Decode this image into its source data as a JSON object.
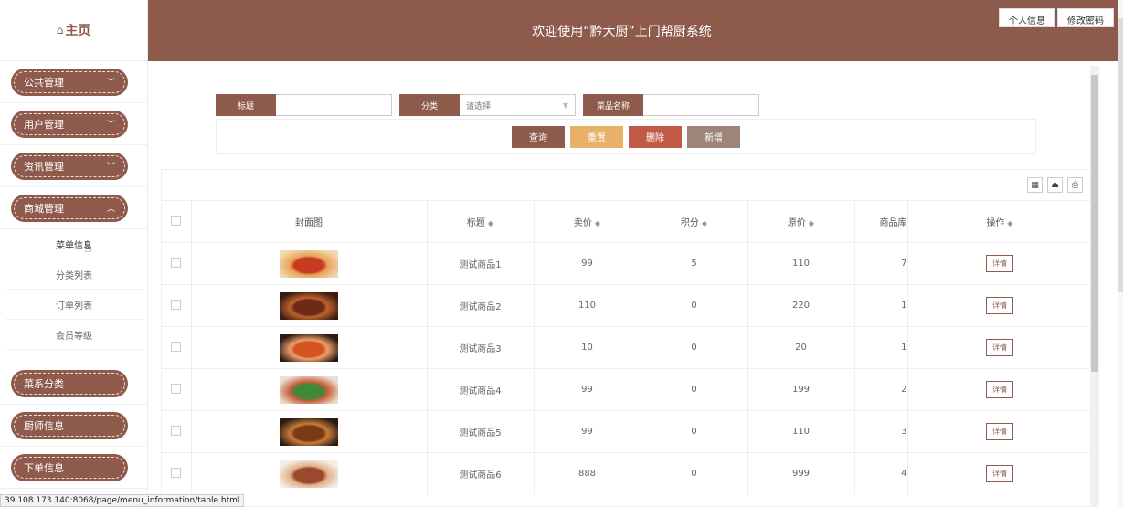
{
  "brand": {
    "icon": "home-icon",
    "title": "主页"
  },
  "sidebar": {
    "menus_top": [
      {
        "label": "公共管理",
        "expanded": false
      },
      {
        "label": "用户管理",
        "expanded": false
      },
      {
        "label": "资讯管理",
        "expanded": false
      },
      {
        "label": "商城管理",
        "expanded": true
      }
    ],
    "submenu": [
      {
        "label": "菜单信息",
        "active": true
      },
      {
        "label": "分类列表"
      },
      {
        "label": "订单列表"
      },
      {
        "label": "会员等级"
      }
    ],
    "menus_bottom": [
      {
        "label": "菜系分类"
      },
      {
        "label": "厨师信息"
      },
      {
        "label": "下单信息"
      }
    ]
  },
  "header": {
    "title": "欢迎使用“黔大厨”上门帮厨系统",
    "links": [
      "个人信息",
      "修改密码"
    ]
  },
  "search": {
    "title_label": "标题",
    "category_label": "分类",
    "category_placeholder": "请选择",
    "name_label": "菜品名称",
    "buttons": {
      "query": "查询",
      "reset": "重置",
      "delete": "删除",
      "add": "新增"
    }
  },
  "table": {
    "columns": [
      "封面图",
      "标题",
      "卖价",
      "积分",
      "原价",
      "商品库",
      "操作"
    ],
    "rows": [
      {
        "title": "测试商品1",
        "price": "99",
        "points": "5",
        "original": "110",
        "stock": "7",
        "action": "详情"
      },
      {
        "title": "测试商品2",
        "price": "110",
        "points": "0",
        "original": "220",
        "stock": "1",
        "action": "详情"
      },
      {
        "title": "测试商品3",
        "price": "10",
        "points": "0",
        "original": "20",
        "stock": "1",
        "action": "详情"
      },
      {
        "title": "测试商品4",
        "price": "99",
        "points": "0",
        "original": "199",
        "stock": "2",
        "action": "详情"
      },
      {
        "title": "测试商品5",
        "price": "99",
        "points": "0",
        "original": "110",
        "stock": "3",
        "action": "详情"
      },
      {
        "title": "测试商品6",
        "price": "888",
        "points": "0",
        "original": "999",
        "stock": "4",
        "action": "详情"
      }
    ]
  },
  "status_url": "39.108.173.140:8068/page/menu_information/table.html",
  "colors": {
    "brand": "#8e5a4c",
    "reset": "#e9b06a",
    "delete": "#c25a47",
    "add": "#9e8579"
  }
}
